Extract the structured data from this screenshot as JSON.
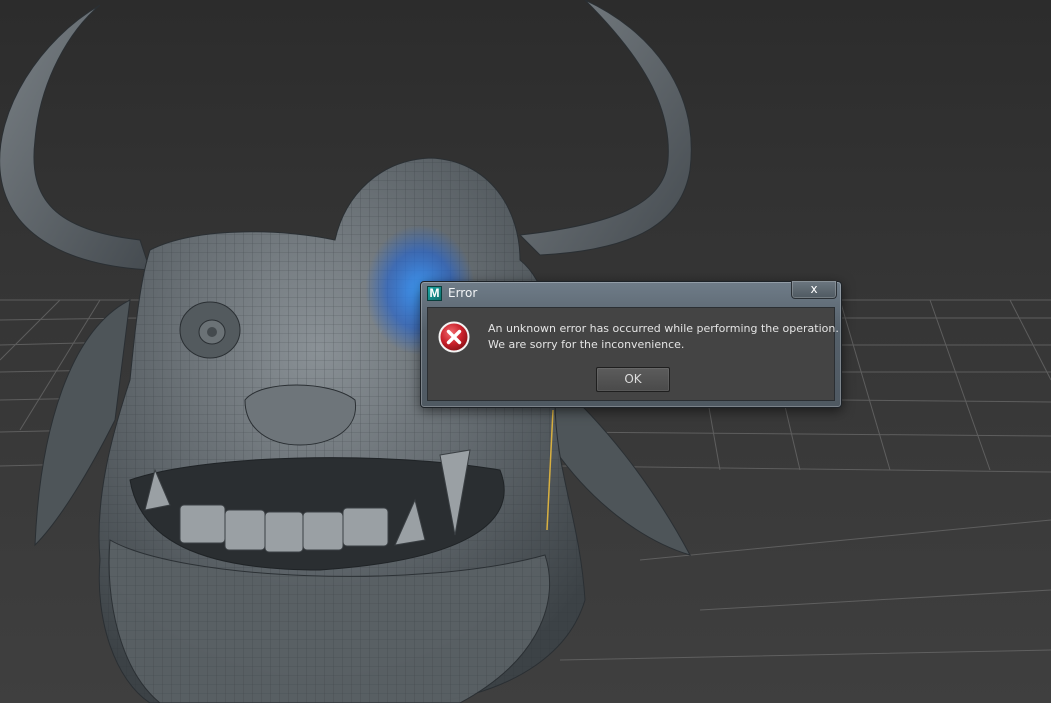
{
  "dialog": {
    "title": "Error",
    "app_icon_letter": "M",
    "close_label": "x",
    "message_line1": "An unknown error has occurred while performing the operation.",
    "message_line2": "We are sorry for the inconvenience.",
    "ok_label": "OK",
    "error_icon": "error-x-icon"
  },
  "colors": {
    "dialog_frame": "#55606a",
    "dialog_body": "#444444",
    "viewport_bg": "#363636",
    "error_red": "#c8202a",
    "highlight_blue": "#1e7cff"
  }
}
